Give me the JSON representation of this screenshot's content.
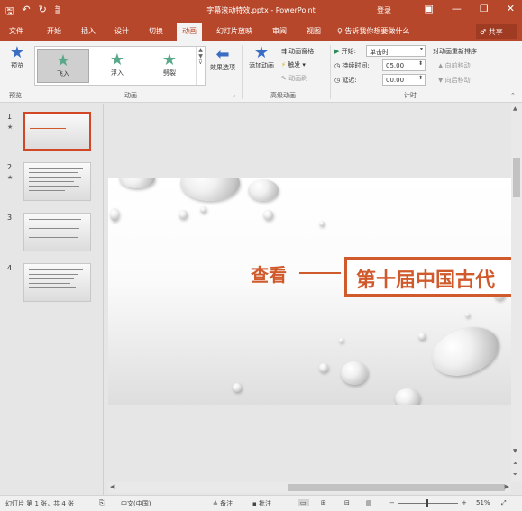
{
  "titlebar": {
    "title": "字幕滚动特效.pptx - PowerPoint",
    "login": "登录",
    "qat_icons": [
      "save-icon",
      "undo-icon",
      "redo-icon",
      "customize-icon"
    ],
    "window_buttons": [
      "ribbon-options-icon",
      "minimize-icon",
      "restore-icon",
      "close-icon"
    ]
  },
  "tabs": [
    "文件",
    "开始",
    "插入",
    "设计",
    "切换",
    "动画",
    "幻灯片放映",
    "审阅",
    "视图"
  ],
  "active_tab": "动画",
  "tellme": "♀ 告诉我你想要做什么",
  "share": "♂ 共享",
  "ribbon": {
    "preview": {
      "label": "预览",
      "group": "预览"
    },
    "animations": {
      "group": "动画",
      "items": [
        "飞入",
        "浮入",
        "劈裂"
      ],
      "selected": "飞入",
      "effect_options": "效果选项"
    },
    "advanced": {
      "group": "高级动画",
      "add_animation": "添加动画",
      "pane": "动画窗格",
      "trigger": "触发 ▾",
      "painter": "动画刷"
    },
    "timing": {
      "group": "计时",
      "start_label": "开始:",
      "start_value": "单击时",
      "duration_label": "持续时间:",
      "duration_value": "05.00",
      "delay_label": "延迟:",
      "delay_value": "00.00",
      "reorder": "对动画重新排序",
      "move_earlier": "▲ 向前移动",
      "move_later": "▼ 向后移动"
    }
  },
  "thumbnails": [
    {
      "num": "1",
      "star": "★",
      "selected": true
    },
    {
      "num": "2",
      "star": "★",
      "selected": false
    },
    {
      "num": "3",
      "star": "",
      "selected": false
    },
    {
      "num": "4",
      "star": "",
      "selected": false
    }
  ],
  "slide": {
    "label": "查看",
    "title": "第十届中国古代"
  },
  "statusbar": {
    "slide_info": "幻灯片 第 1 张，共 4 张",
    "language": "中文(中国)",
    "notes": "≜ 备注",
    "comments": "▪ 批注",
    "zoom": "51%"
  },
  "colors": {
    "brand": "#b7472a",
    "accent_text": "#d05a2c"
  }
}
